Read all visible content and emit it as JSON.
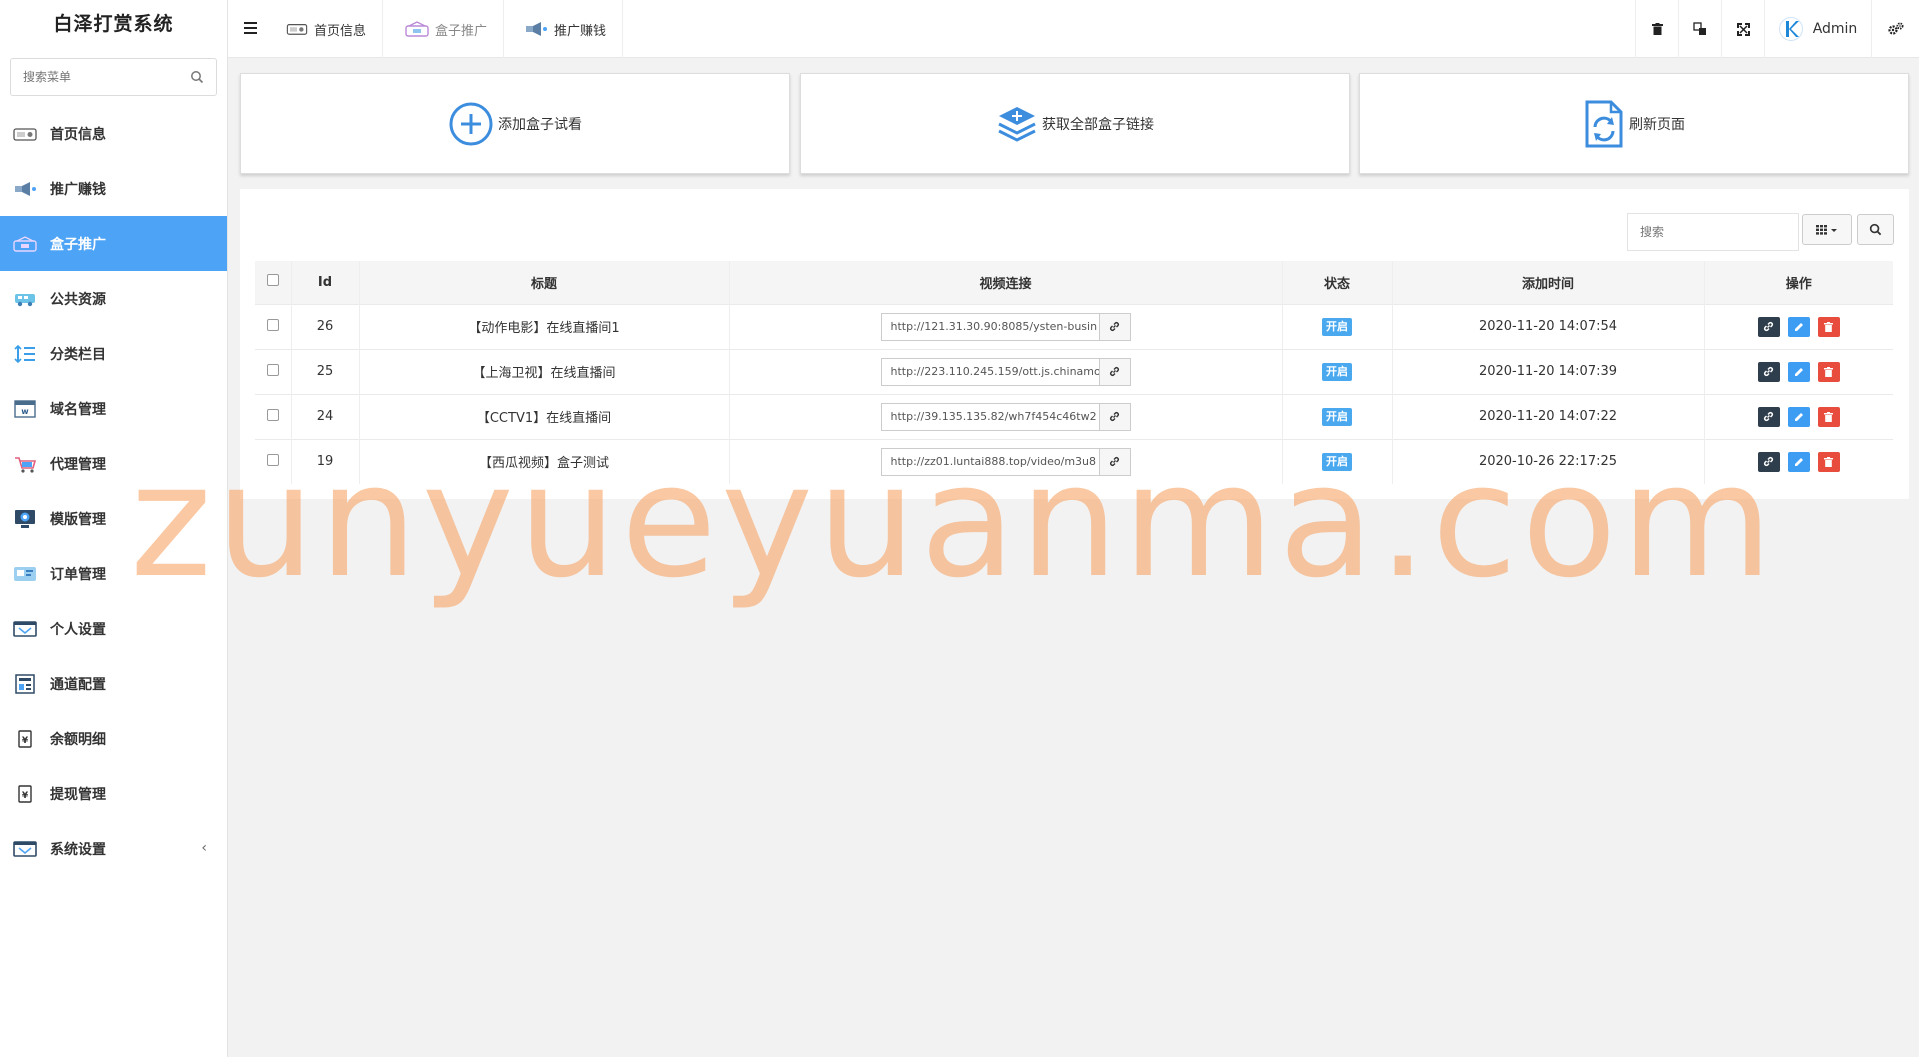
{
  "app": {
    "title": "白泽打赏系统"
  },
  "sidebar": {
    "search_placeholder": "搜索菜单",
    "items": [
      {
        "label": "首页信息",
        "icon": "home-info-icon"
      },
      {
        "label": "推广赚钱",
        "icon": "promo-icon"
      },
      {
        "label": "盒子推广",
        "icon": "box-promo-icon",
        "active": true
      },
      {
        "label": "公共资源",
        "icon": "resource-icon"
      },
      {
        "label": "分类栏目",
        "icon": "category-icon"
      },
      {
        "label": "域名管理",
        "icon": "domain-icon"
      },
      {
        "label": "代理管理",
        "icon": "agent-icon"
      },
      {
        "label": "模版管理",
        "icon": "template-icon"
      },
      {
        "label": "订单管理",
        "icon": "order-icon"
      },
      {
        "label": "个人设置",
        "icon": "profile-icon"
      },
      {
        "label": "通道配置",
        "icon": "channel-icon"
      },
      {
        "label": "余额明细",
        "icon": "balance-icon"
      },
      {
        "label": "提现管理",
        "icon": "withdraw-icon"
      },
      {
        "label": "系统设置",
        "icon": "system-icon",
        "chevron": "‹"
      }
    ]
  },
  "topbar": {
    "tabs": [
      {
        "label": "首页信息"
      },
      {
        "label": "盒子推广"
      },
      {
        "label": "推广赚钱"
      }
    ],
    "user": "Admin"
  },
  "actions": {
    "add_box": "添加盒子试看",
    "get_links": "获取全部盒子链接",
    "refresh": "刷新页面"
  },
  "table": {
    "search_placeholder": "搜索",
    "columns": [
      "Id",
      "标题",
      "视频连接",
      "状态",
      "添加时间",
      "操作"
    ],
    "rows": [
      {
        "id": "26",
        "title": "【动作电影】在线直播间1",
        "url": "http://121.31.30.90:8085/ysten-busin",
        "status": "开启",
        "time": "2020-11-20 14:07:54"
      },
      {
        "id": "25",
        "title": "【上海卫视】在线直播间",
        "url": "http://223.110.245.159/ott.js.chinamo",
        "status": "开启",
        "time": "2020-11-20 14:07:39"
      },
      {
        "id": "24",
        "title": "【CCTV1】在线直播间",
        "url": "http://39.135.135.82/wh7f454c46tw2",
        "status": "开启",
        "time": "2020-11-20 14:07:22"
      },
      {
        "id": "19",
        "title": "【西瓜视频】盒子测试",
        "url": "http://zz01.luntai888.top/video/m3u8",
        "status": "开启",
        "time": "2020-10-26 22:17:25"
      }
    ]
  },
  "watermark": "zunyueyuanma.com",
  "colors": {
    "accent": "#4da3f5",
    "badge": "#4aa8ef",
    "danger": "#e74c3c",
    "dark": "#2f3e4c"
  }
}
